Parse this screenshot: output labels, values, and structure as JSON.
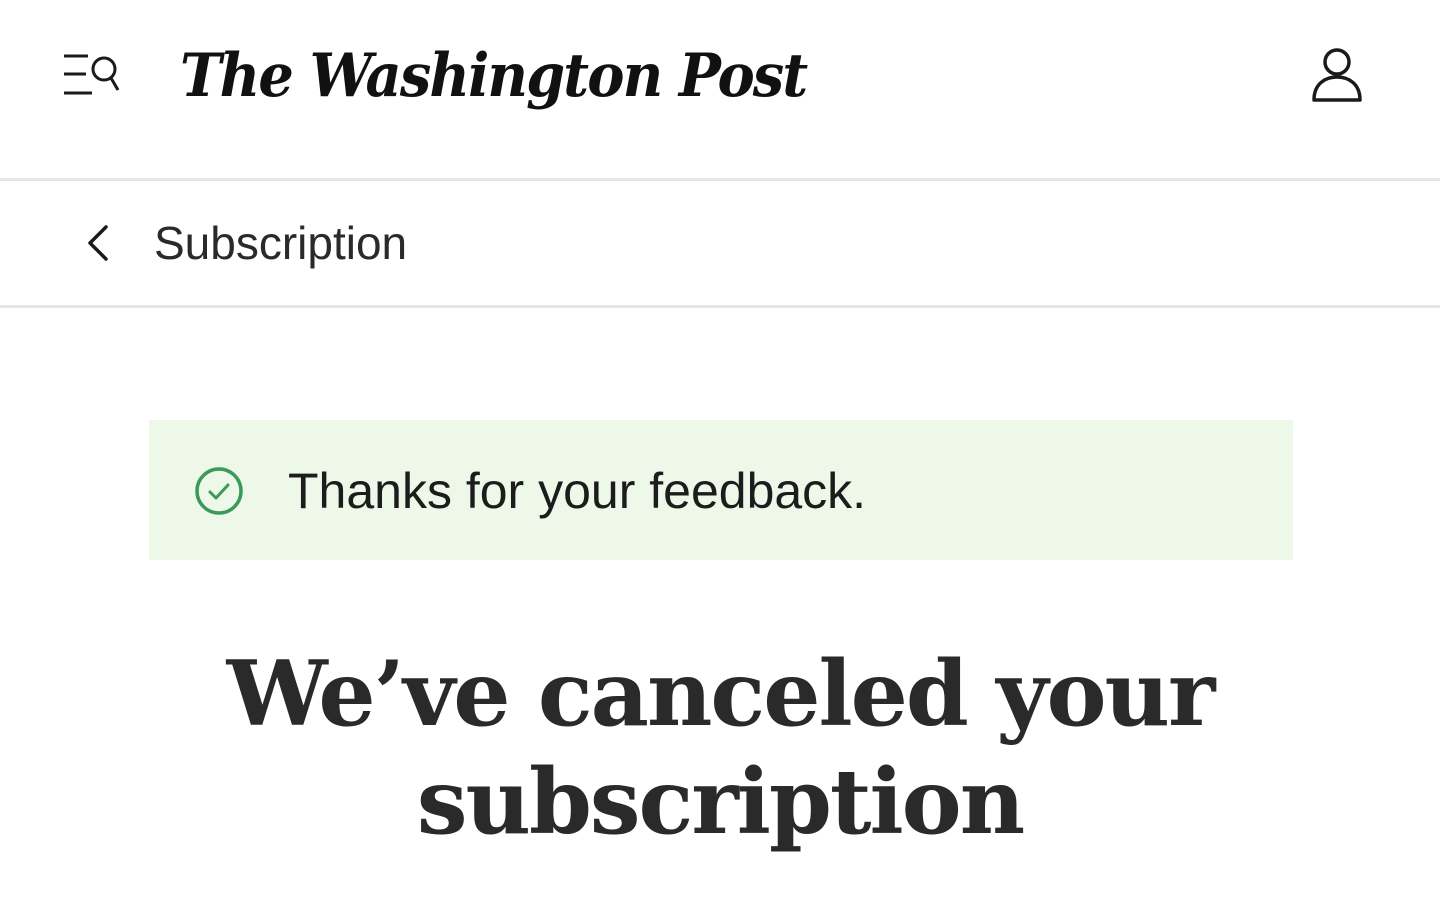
{
  "header": {
    "menu_icon": "menu-search-icon",
    "logo_text": "The Washington Post",
    "account_icon": "user-icon"
  },
  "subnav": {
    "back_icon": "chevron-left-icon",
    "title": "Subscription"
  },
  "alert": {
    "icon": "check-circle-icon",
    "message": "Thanks for your feedback.",
    "background": "#edf8e8",
    "icon_color": "#3a9a5b"
  },
  "main": {
    "headline_line1": "We’ve canceled your",
    "headline_line2": "subscription"
  }
}
